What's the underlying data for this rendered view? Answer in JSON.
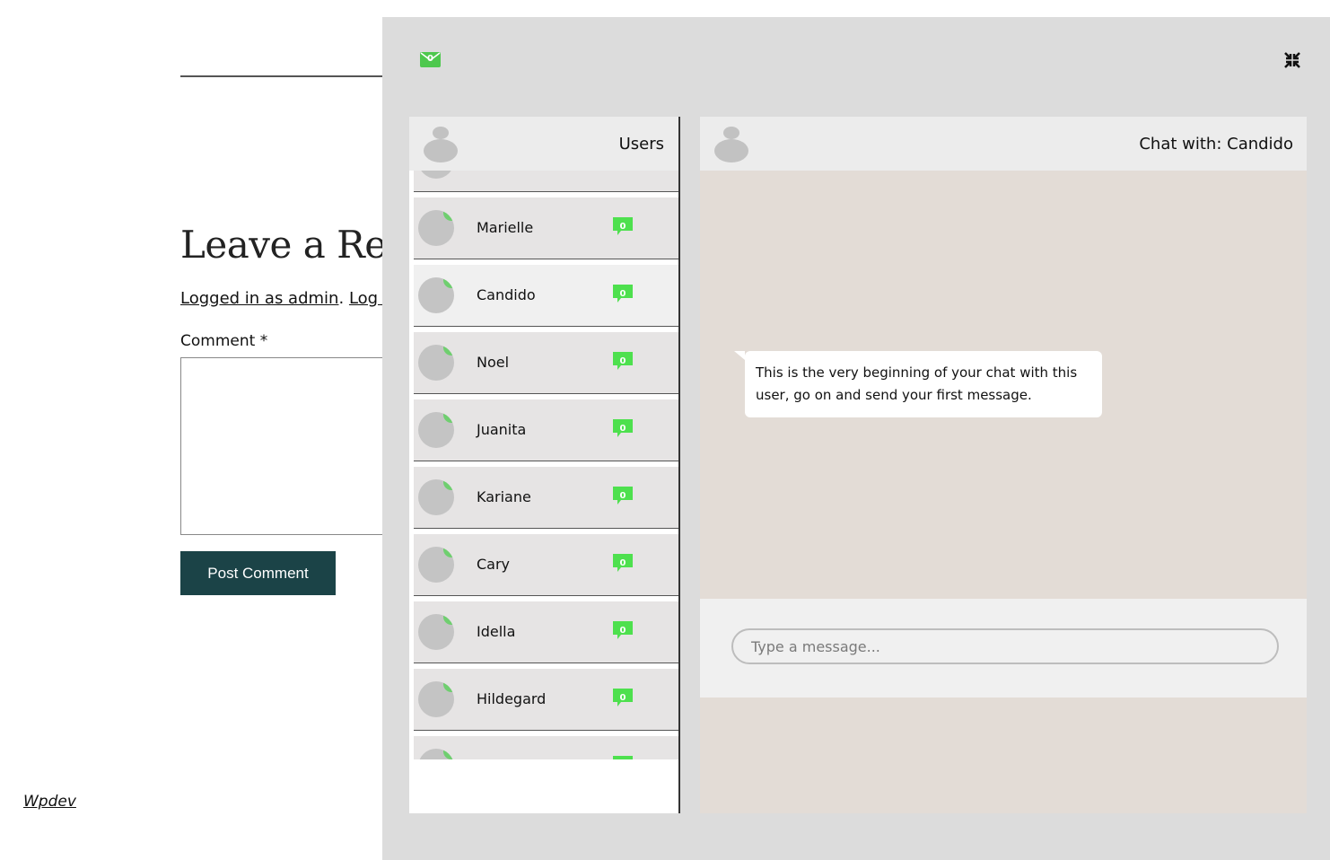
{
  "page": {
    "reply_title": "Leave a Repl",
    "logged_in": "Logged in as admin",
    "separator": ".",
    "log_out": "Log out",
    "comment_label": "Comment *",
    "post_button": "Post Comment",
    "footer_link": "Wpdev"
  },
  "chat": {
    "mail_count": "0",
    "users_title": "Users",
    "chat_title": "Chat with: Candido",
    "users": [
      {
        "name": "",
        "count": "",
        "active": false
      },
      {
        "name": "Marielle",
        "count": "0",
        "active": false
      },
      {
        "name": "Candido",
        "count": "0",
        "active": true
      },
      {
        "name": "Noel",
        "count": "0",
        "active": false
      },
      {
        "name": "Juanita",
        "count": "0",
        "active": false
      },
      {
        "name": "Kariane",
        "count": "0",
        "active": false
      },
      {
        "name": "Cary",
        "count": "0",
        "active": false
      },
      {
        "name": "Idella",
        "count": "0",
        "active": false
      },
      {
        "name": "Hildegard",
        "count": "0",
        "active": false
      },
      {
        "name": "",
        "count": "",
        "active": false
      }
    ],
    "welcome_message": "This is the very beginning of your chat with this user, go on and send your first message.",
    "input_placeholder": "Type a message..."
  },
  "colors": {
    "badge_green": "#4ec84e",
    "button_bg": "#1b4347",
    "chat_bg": "#e3dcd6"
  },
  "icons": [
    "mail-icon",
    "collapse-icon",
    "avatar-icon",
    "message-badge-icon"
  ]
}
